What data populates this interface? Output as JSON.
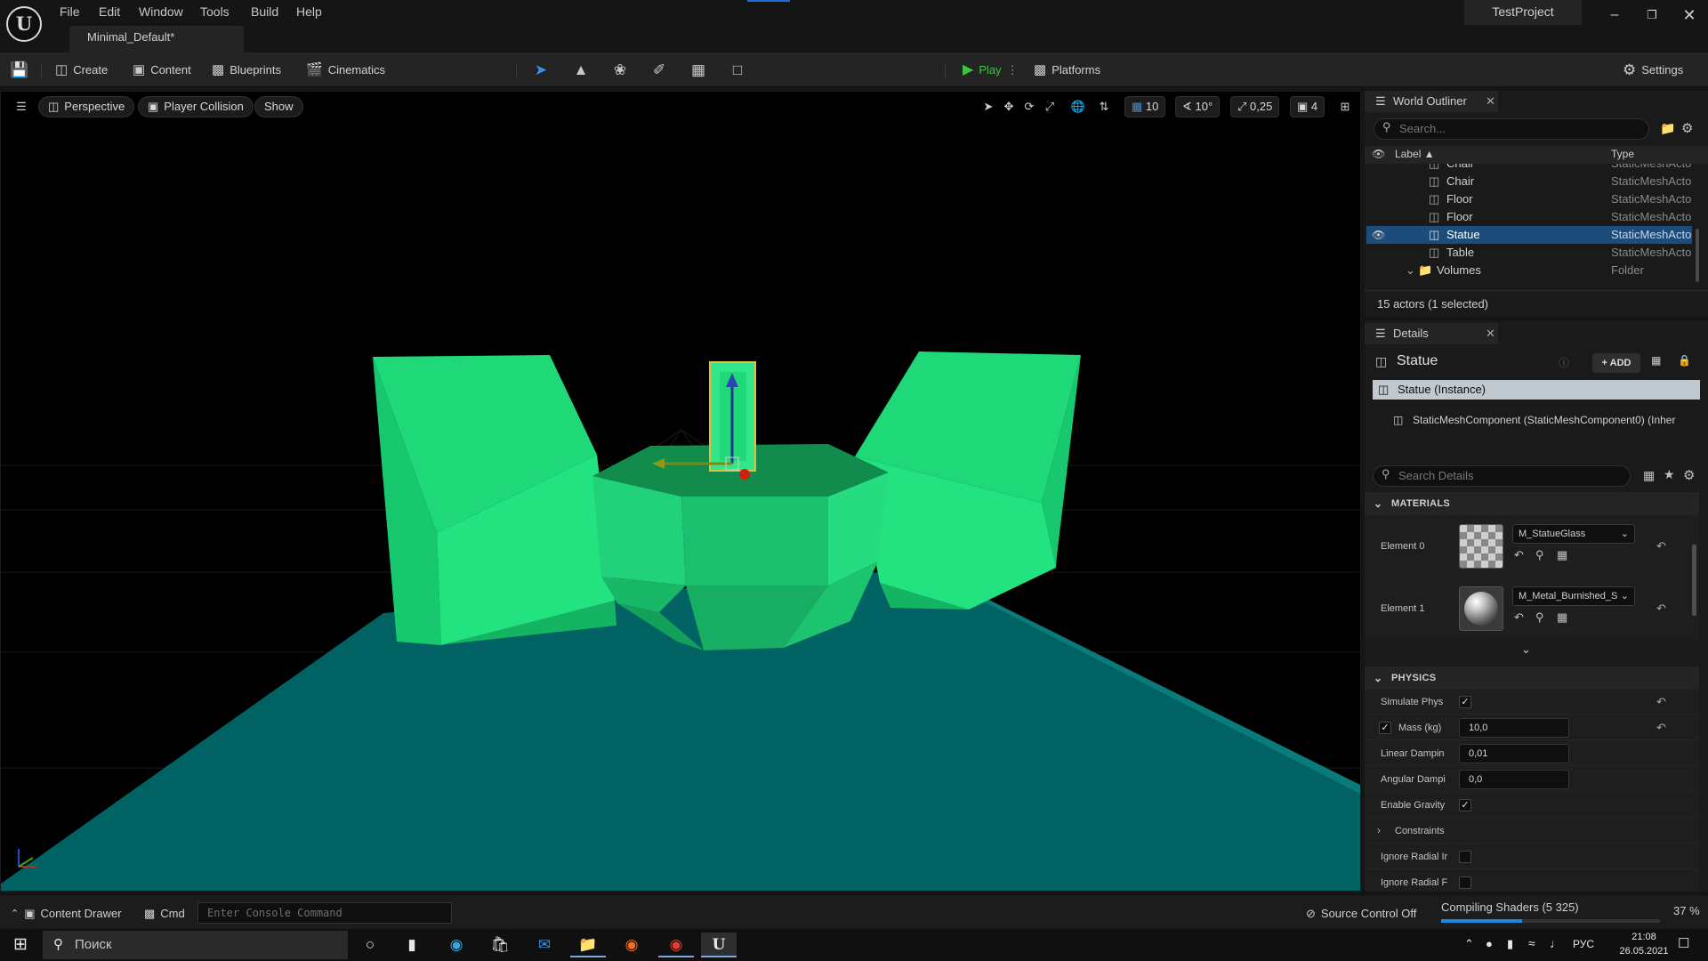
{
  "app": {
    "logo_glyph": "U",
    "menu": [
      "File",
      "Edit",
      "Window",
      "Tools",
      "Build",
      "Help"
    ],
    "doc_tab": "Minimal_Default*",
    "project_name": "TestProject",
    "window_controls": [
      "minimize-icon",
      "restore-icon",
      "close-icon"
    ]
  },
  "toolbar": {
    "create": "Create",
    "content": "Content",
    "blueprints": "Blueprints",
    "cinematics": "Cinematics",
    "play": "Play",
    "platforms": "Platforms",
    "settings": "Settings",
    "mode_tools": [
      "select-mode-icon",
      "landscape-mode-icon",
      "foliage-mode-icon",
      "mesh-paint-mode-icon",
      "fracture-mode-icon",
      "brush-edit-mode-icon"
    ],
    "play_color": "#3cc43c"
  },
  "viewport": {
    "perspective": "Perspective",
    "view_mode": "Player Collision",
    "show": "Show",
    "grid_snap": "10",
    "rotation_snap": "10°",
    "scale_snap": "0,25",
    "camera_speed": "4",
    "mesh_color": "#1fd979",
    "floor_color": "#006262"
  },
  "outliner": {
    "title": "World Outliner",
    "search_placeholder": "Search...",
    "col_label": "Label",
    "col_type": "Type",
    "rows": [
      {
        "label": "Chair",
        "type": "StaticMeshActo",
        "partial": true
      },
      {
        "label": "Chair",
        "type": "StaticMeshActo"
      },
      {
        "label": "Floor",
        "type": "StaticMeshActo"
      },
      {
        "label": "Floor",
        "type": "StaticMeshActo"
      },
      {
        "label": "Statue",
        "type": "StaticMeshActo",
        "selected": true
      },
      {
        "label": "Table",
        "type": "StaticMeshActo"
      },
      {
        "label": "Volumes",
        "type": "Folder",
        "folder": true
      }
    ],
    "footer": "15 actors (1 selected)"
  },
  "details": {
    "title": "Details",
    "actor_name": "Statue",
    "add_button": "ADD",
    "instance_row": "Statue (Instance)",
    "component_row": "StaticMeshComponent (StaticMeshComponent0) (Inher",
    "search_placeholder": "Search Details",
    "materials_header": "MATERIALS",
    "materials": [
      {
        "label": "Element 0",
        "material": "M_StatueGlass"
      },
      {
        "label": "Element 1",
        "material": "M_Metal_Burnished_S"
      }
    ],
    "physics_header": "PHYSICS",
    "physics": {
      "simulate_label": "Simulate Phys",
      "simulate_checked": true,
      "mass_label": "Mass (kg)",
      "mass_value": "10,0",
      "linear_label": "Linear Dampin",
      "linear_value": "0,01",
      "angular_label": "Angular Dampi",
      "angular_value": "0,0",
      "gravity_label": "Enable Gravity",
      "gravity_checked": true,
      "constraints_label": "Constraints",
      "radial_impulse_label": "Ignore Radial Ir",
      "radial_force_label": "Ignore Radial F"
    }
  },
  "statusbar": {
    "content_drawer": "Content Drawer",
    "cmd": "Cmd",
    "console_placeholder": "Enter Console Command",
    "source_control": "Source Control Off",
    "compiling": "Compiling Shaders (5 325)",
    "progress_percent": 37,
    "progress_label": "37 %"
  },
  "taskbar": {
    "search": "Поиск",
    "lang": "РУС",
    "time": "21:08",
    "date": "26.05.2021"
  }
}
